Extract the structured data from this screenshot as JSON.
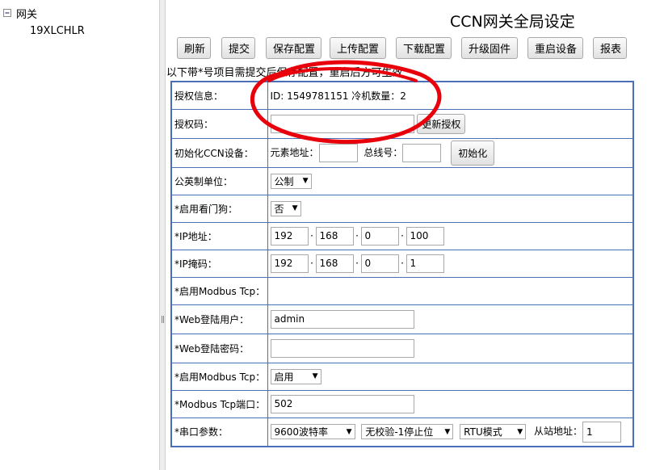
{
  "sidebar": {
    "root_label": "网关",
    "toggle_symbol": "−",
    "child_label": "19XLCHLR",
    "splitter_grip": "||"
  },
  "page": {
    "title": "CCN网关全局设定",
    "note": "以下带*号项目需提交后保存配置，重启后方可生效"
  },
  "toolbar": {
    "refresh": "刷新",
    "submit": "提交",
    "save_config": "保存配置",
    "upload_config": "上传配置",
    "download_config": "下载配置",
    "upgrade_firmware": "升级固件",
    "restart_device": "重启设备",
    "report": "报表"
  },
  "settings": {
    "license_info": {
      "label": "授权信息：",
      "value": "ID: 1549781151 冷机数量：2"
    },
    "license_code": {
      "label": "授权码：",
      "value": "",
      "button": "更新授权"
    },
    "init_ccn": {
      "label": "初始化CCN设备：",
      "element_addr_label": "元素地址：",
      "element_addr_value": "",
      "bus_no_label": "总线号：",
      "bus_no_value": "",
      "button": "初始化"
    },
    "unit_system": {
      "label": "公英制单位：",
      "selected": "公制"
    },
    "watchdog": {
      "label": "*启用看门狗：",
      "selected": "否"
    },
    "ip_address": {
      "label": "*IP地址：",
      "octets": [
        "192",
        "168",
        "0",
        "100"
      ]
    },
    "ip_mask": {
      "label": "*IP掩码：",
      "octets": [
        "192",
        "168",
        "0",
        "1"
      ]
    },
    "modbus_enable_1": {
      "label": "*启用Modbus Tcp："
    },
    "web_user": {
      "label": "*Web登陆用户：",
      "value": "admin"
    },
    "web_password": {
      "label": "*Web登陆密码：",
      "value": ""
    },
    "modbus_enable_2": {
      "label": "*启用Modbus Tcp：",
      "selected": "启用"
    },
    "modbus_port": {
      "label": "*Modbus Tcp端口：",
      "value": "502"
    },
    "serial": {
      "label": "*串口参数：",
      "baud": "9600波特率",
      "parity": "无校验-1停止位",
      "mode": "RTU模式",
      "slave_label": "从站地址：",
      "slave_value": "1"
    }
  },
  "annotation": {
    "color": "#e8000a"
  }
}
